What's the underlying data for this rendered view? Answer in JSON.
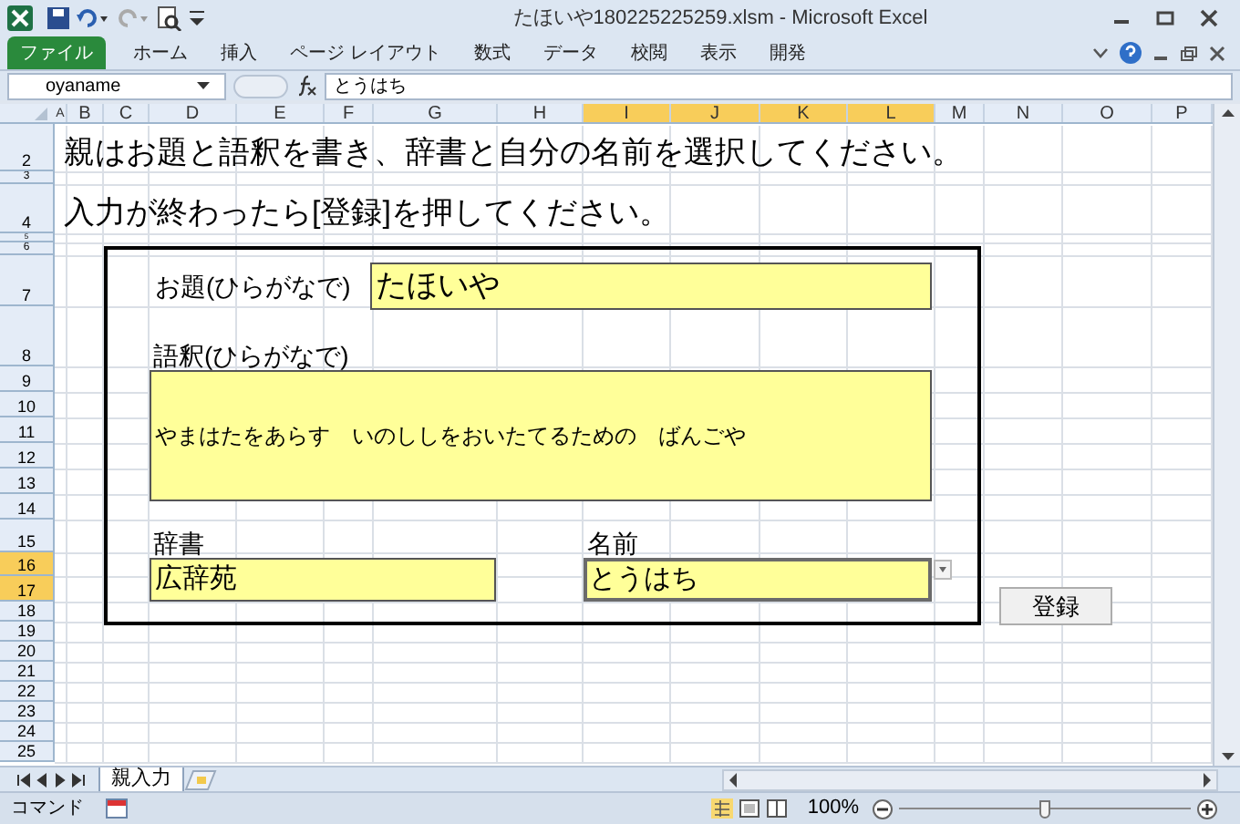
{
  "window": {
    "title": "たほいや180225225259.xlsm  -  Microsoft Excel"
  },
  "ribbon_tabs": [
    {
      "label": "ファイル",
      "selected": true
    },
    {
      "label": "ホーム",
      "selected": false
    },
    {
      "label": "挿入",
      "selected": false
    },
    {
      "label": "ページ レイアウト",
      "selected": false
    },
    {
      "label": "数式",
      "selected": false
    },
    {
      "label": "データ",
      "selected": false
    },
    {
      "label": "校閲",
      "selected": false
    },
    {
      "label": "表示",
      "selected": false
    },
    {
      "label": "開発",
      "selected": false
    }
  ],
  "formula_bar": {
    "name_box": "oyaname",
    "content": "とうはち"
  },
  "columns": [
    {
      "label": "A",
      "selected": false
    },
    {
      "label": "B",
      "selected": false
    },
    {
      "label": "C",
      "selected": false
    },
    {
      "label": "D",
      "selected": false
    },
    {
      "label": "E",
      "selected": false
    },
    {
      "label": "F",
      "selected": false
    },
    {
      "label": "G",
      "selected": false
    },
    {
      "label": "H",
      "selected": false
    },
    {
      "label": "I",
      "selected": true
    },
    {
      "label": "J",
      "selected": true
    },
    {
      "label": "K",
      "selected": true
    },
    {
      "label": "L",
      "selected": true
    },
    {
      "label": "M",
      "selected": false
    },
    {
      "label": "N",
      "selected": false
    },
    {
      "label": "O",
      "selected": false
    },
    {
      "label": "P",
      "selected": false
    }
  ],
  "rows": [
    {
      "label": "2",
      "selected": false
    },
    {
      "label": "3",
      "selected": false
    },
    {
      "label": "4",
      "selected": false
    },
    {
      "label": "5",
      "selected": false
    },
    {
      "label": "6",
      "selected": false
    },
    {
      "label": "7",
      "selected": false
    },
    {
      "label": "8",
      "selected": false
    },
    {
      "label": "9",
      "selected": false
    },
    {
      "label": "10",
      "selected": false
    },
    {
      "label": "11",
      "selected": false
    },
    {
      "label": "12",
      "selected": false
    },
    {
      "label": "13",
      "selected": false
    },
    {
      "label": "14",
      "selected": false
    },
    {
      "label": "15",
      "selected": false
    },
    {
      "label": "16",
      "selected": true
    },
    {
      "label": "17",
      "selected": true
    },
    {
      "label": "18",
      "selected": false
    },
    {
      "label": "19",
      "selected": false
    },
    {
      "label": "20",
      "selected": false
    },
    {
      "label": "21",
      "selected": false
    },
    {
      "label": "22",
      "selected": false
    },
    {
      "label": "23",
      "selected": false
    },
    {
      "label": "24",
      "selected": false
    },
    {
      "label": "25",
      "selected": false
    }
  ],
  "instructions": [
    "親はお題と語釈を書き、辞書と自分の名前を選択してください。",
    "入力が終わったら[登録]を押してください。"
  ],
  "form": {
    "title_label": "お題(ひらがなで)",
    "title_value": "たほいや",
    "meaning_label": "語釈(ひらがなで)",
    "meaning_value": "やまはたをあらす　いのししをおいたてるための　ばんごや",
    "dictionary_label": "辞書",
    "dictionary_value": "広辞苑",
    "name_label": "名前",
    "name_value": "とうはち"
  },
  "register_button": "登録",
  "sheet_tabs": [
    {
      "label": "親入力",
      "selected": true
    }
  ],
  "status_bar": {
    "mode": "コマンド",
    "zoom": "100%",
    "zoom_level": {
      "level": 0.5
    }
  }
}
